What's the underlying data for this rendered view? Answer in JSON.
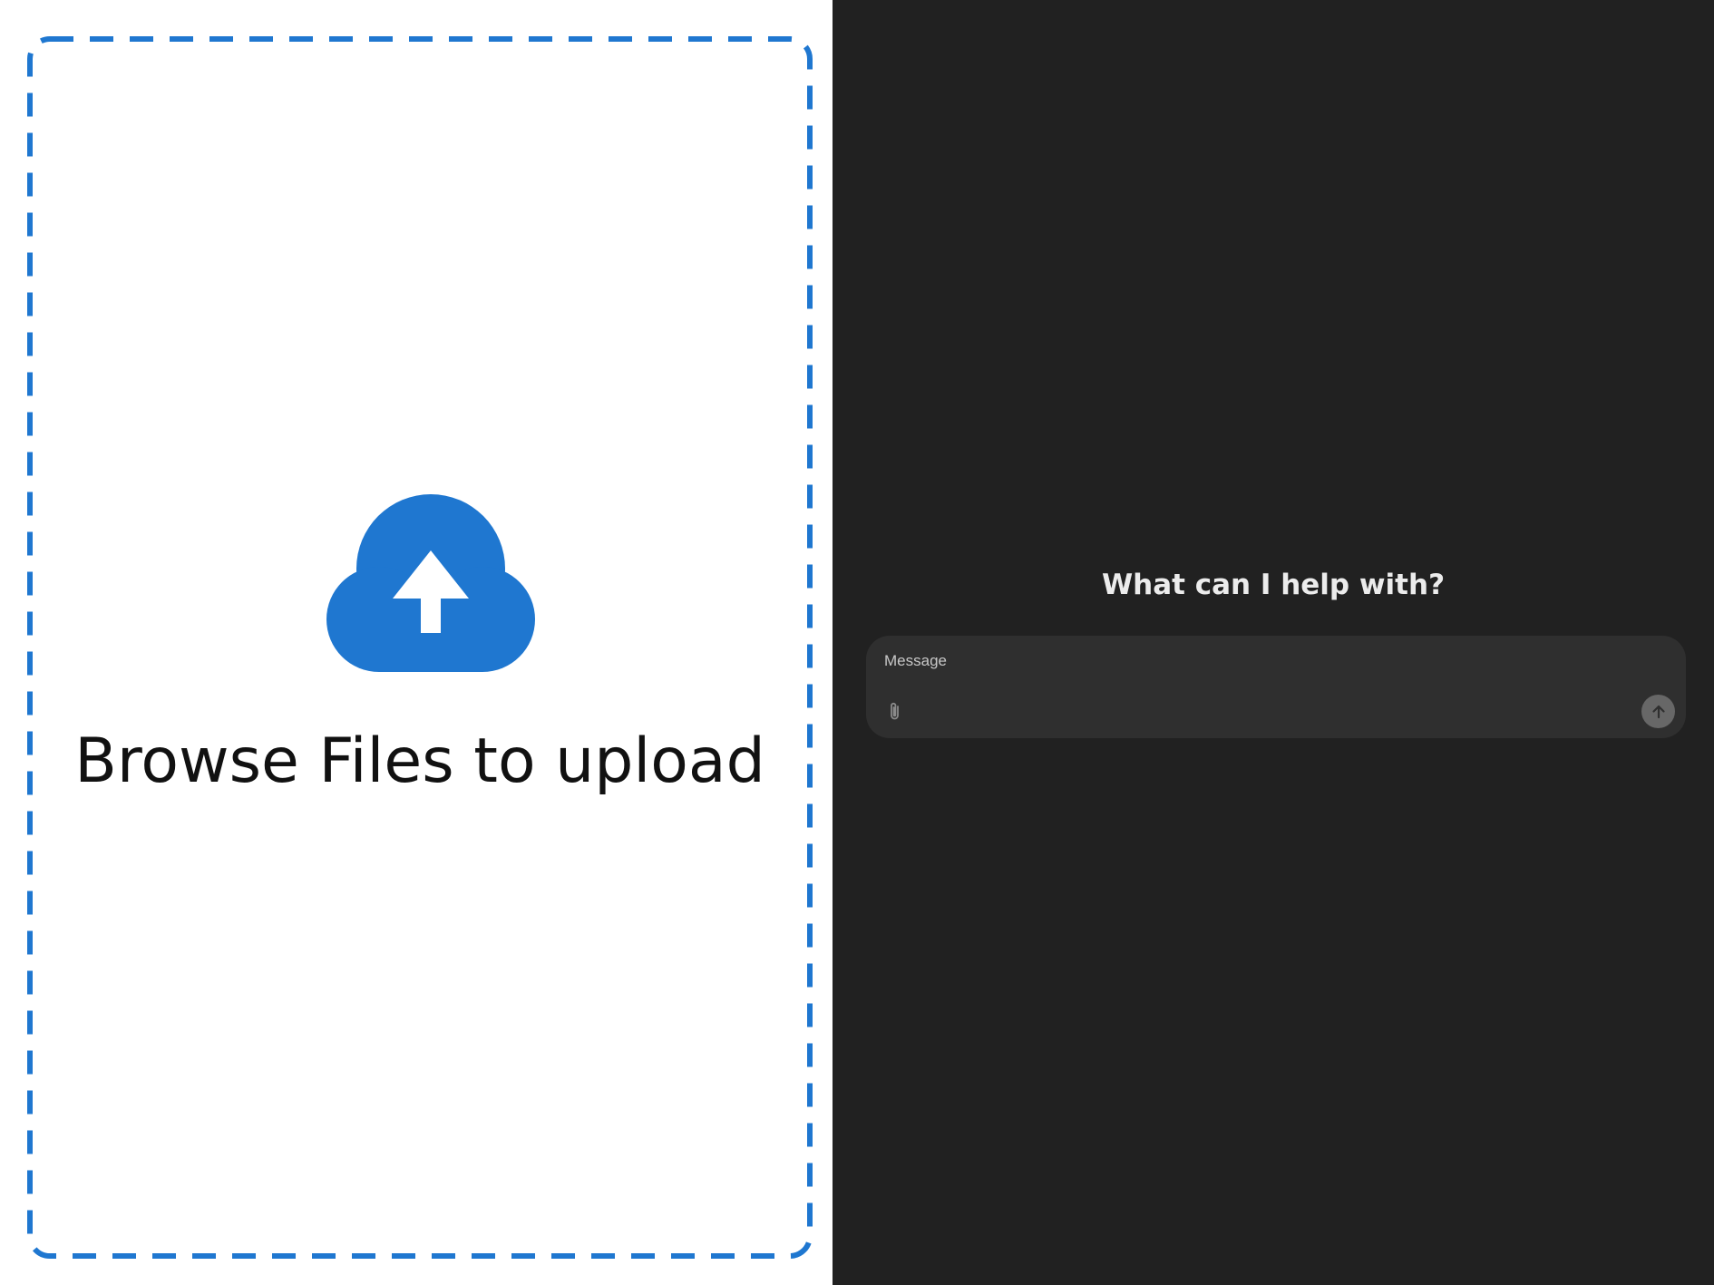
{
  "upload_panel": {
    "label": "Browse Files to upload",
    "icon": "cloud-upload-icon",
    "accent_color": "#1f77d0",
    "border_style": "dashed"
  },
  "chat_panel": {
    "heading": "What can I help with?",
    "input": {
      "placeholder": "Message",
      "value": ""
    },
    "attach_icon": "paperclip-icon",
    "send_icon": "arrow-up-icon",
    "background_color": "#212121",
    "composer_color": "#2f2f2f"
  }
}
